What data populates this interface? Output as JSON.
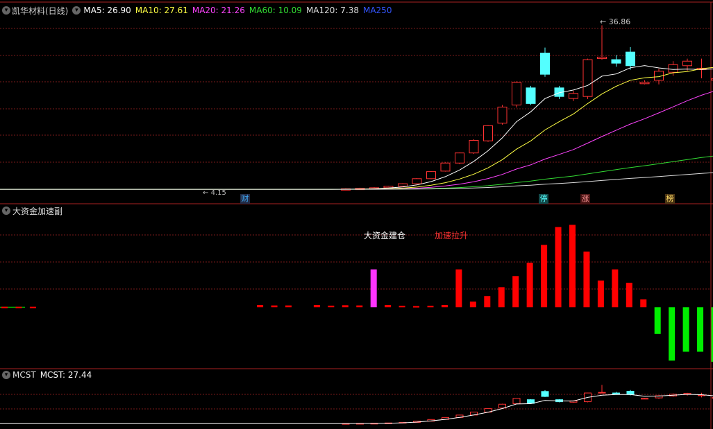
{
  "main_panel": {
    "title": "凯华材料(日线)",
    "ma_labels": [
      {
        "text": "MA5: 26.90",
        "color": "#ffffff"
      },
      {
        "text": "MA10: 27.61",
        "color": "#ffff44"
      },
      {
        "text": "MA20: 21.26",
        "color": "#ff44ff"
      },
      {
        "text": "MA60: 10.09",
        "color": "#33dd33"
      },
      {
        "text": "MA120: 7.38",
        "color": "#dddddd"
      },
      {
        "text": "MA250",
        "color": "#3355ff"
      }
    ],
    "high_label": "36.86",
    "low_label": "4.15",
    "markers": [
      {
        "text": "财",
        "color": "#3fa9f5",
        "box": "#222a44"
      },
      {
        "text": "停",
        "color": "#55ffff",
        "box": "#124a4a"
      },
      {
        "text": "涨",
        "color": "#ff9999",
        "box": "#4a1414"
      },
      {
        "text": "榜",
        "color": "#ffdd66",
        "box": "#4a3414"
      }
    ]
  },
  "indicator_panel": {
    "title": "大资金加速副",
    "annotations": [
      {
        "text": "大资金建仓",
        "color": "#ffffff"
      },
      {
        "text": "加速拉升",
        "color": "#ff3333"
      }
    ]
  },
  "mcst_panel": {
    "title": "MCST",
    "value_label": "MCST: 27.44"
  },
  "colors": {
    "up": "#ff3232",
    "down": "#54ffff",
    "grid": "#7a1a1a",
    "panel_border": "#aa2222",
    "build": "#ff33ff",
    "accel": "#ff0000",
    "negative": "#00ee00",
    "mcst_line": "#ffffff"
  },
  "chart_data": [
    {
      "type": "candlestick",
      "name": "凯华材料(日线)",
      "ohlc": [
        [
          4.4,
          4.6,
          4.3,
          4.5
        ],
        [
          4.5,
          4.7,
          4.4,
          4.6
        ],
        [
          4.6,
          4.8,
          4.5,
          4.7
        ],
        [
          4.7,
          5.1,
          4.6,
          5.0
        ],
        [
          5.0,
          5.6,
          4.9,
          5.5
        ],
        [
          5.5,
          6.6,
          5.4,
          6.5
        ],
        [
          6.5,
          8.0,
          6.4,
          7.9
        ],
        [
          8.0,
          9.7,
          7.9,
          9.6
        ],
        [
          9.6,
          11.7,
          9.4,
          11.6
        ],
        [
          11.6,
          14.3,
          11.4,
          14.1
        ],
        [
          14.0,
          17.1,
          13.8,
          17.0
        ],
        [
          17.5,
          21.1,
          17.2,
          20.7
        ],
        [
          21.1,
          25.8,
          20.6,
          25.6
        ],
        [
          24.5,
          24.9,
          21.1,
          21.4
        ],
        [
          31.4,
          32.5,
          26.7,
          27.2
        ],
        [
          24.5,
          24.9,
          22.3,
          22.8
        ],
        [
          22.4,
          23.9,
          21.9,
          23.4
        ],
        [
          22.8,
          30.3,
          22.3,
          30.1
        ],
        [
          30.3,
          36.9,
          30.1,
          30.6
        ],
        [
          30.1,
          31.0,
          28.7,
          29.4
        ],
        [
          31.6,
          32.6,
          28.1,
          28.9
        ],
        [
          25.6,
          26.0,
          25.2,
          25.6
        ],
        [
          26.0,
          28.3,
          25.2,
          27.8
        ],
        [
          27.6,
          29.8,
          26.9,
          29.1
        ],
        [
          28.9,
          30.3,
          27.9,
          29.8
        ],
        [
          28.4,
          30.3,
          26.4,
          28.4
        ],
        [
          26.3,
          26.6,
          26.0,
          26.3
        ]
      ],
      "ylim": [
        4.0,
        40.0
      ]
    },
    {
      "type": "bar",
      "name": "大资金加速副",
      "values": [
        0.2,
        0.2,
        0.2,
        0,
        0,
        0,
        0,
        0,
        0,
        0,
        0,
        0,
        0,
        0,
        0,
        0,
        0,
        0,
        1.0,
        0.8,
        0.8,
        0,
        1.0,
        0.7,
        0.9,
        0.8,
        17.0,
        1.0,
        0.6,
        0.5,
        0.6,
        1.0,
        17.0,
        2.5,
        5.0,
        9.0,
        14.0,
        20.0,
        28.0,
        36.0,
        37.0,
        25.0,
        12.0,
        17.0,
        11.0,
        3.5,
        -12.0,
        -24.0,
        -20.0,
        -20.0,
        -24.5
      ],
      "highlight": {
        "build_index": 26,
        "accel_index": 32
      },
      "ylim": [
        -27,
        39
      ]
    },
    {
      "type": "line",
      "name": "MCST",
      "value": 27.44
    }
  ]
}
